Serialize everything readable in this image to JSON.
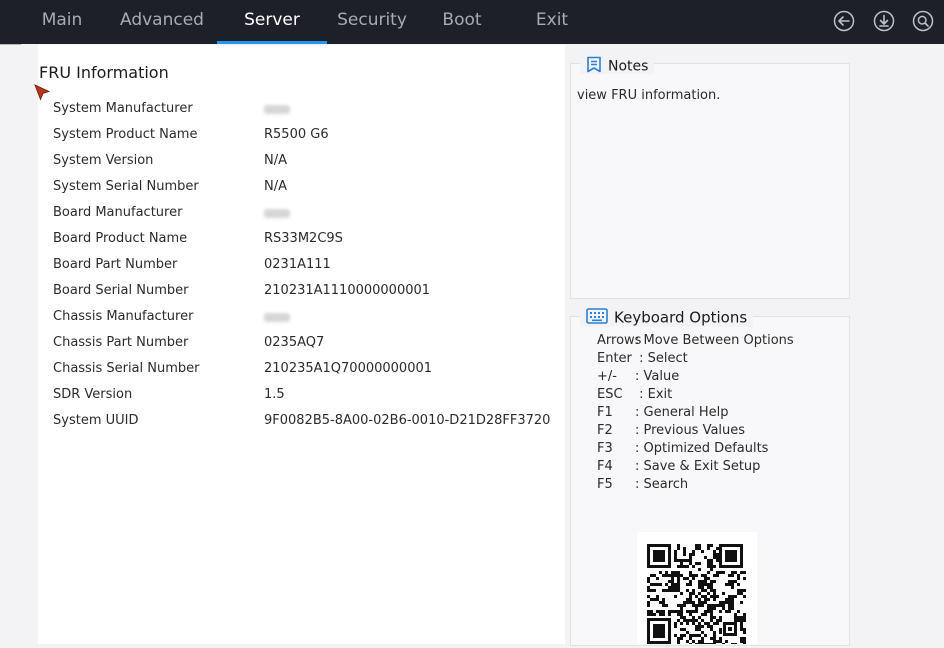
{
  "nav": {
    "tabs": [
      {
        "label": "Main"
      },
      {
        "label": "Advanced"
      },
      {
        "label": "Server"
      },
      {
        "label": "Security"
      },
      {
        "label": "Boot"
      },
      {
        "label": "Exit"
      }
    ],
    "active_tab": "Server",
    "icons": [
      "back-arrow-icon",
      "download-icon",
      "search-icon"
    ],
    "accent_color": "#2196f3"
  },
  "main": {
    "title": "FRU Information",
    "rows": [
      {
        "label": "System Manufacturer",
        "value": "",
        "redacted": true
      },
      {
        "label": "System Product Name",
        "value": "R5500 G6"
      },
      {
        "label": "System Version",
        "value": "N/A"
      },
      {
        "label": "System Serial Number",
        "value": "N/A"
      },
      {
        "label": "Board Manufacturer",
        "value": "",
        "redacted": true
      },
      {
        "label": "Board Product Name",
        "value": "RS33M2C9S"
      },
      {
        "label": "Board Part Number",
        "value": "0231A111"
      },
      {
        "label": "Board Serial Number",
        "value": "210231A1110000000001"
      },
      {
        "label": "Chassis Manufacturer",
        "value": "",
        "redacted": true
      },
      {
        "label": "Chassis Part Number",
        "value": "0235AQ7"
      },
      {
        "label": "Chassis Serial Number",
        "value": "210235A1Q70000000001"
      },
      {
        "label": "SDR Version",
        "value": "1.5"
      },
      {
        "label": "System UUID",
        "value": "9F0082B5-8A00-02B6-0010-D21D28FF3720"
      }
    ]
  },
  "notes": {
    "title": "Notes",
    "text": "view FRU information."
  },
  "keyboard": {
    "title": "Keyboard Options",
    "items": [
      {
        "key": "Arrows",
        "desc": ": Move Between Options"
      },
      {
        "key": "Enter",
        "desc": " : Select"
      },
      {
        "key": "+/-",
        "desc": ": Value"
      },
      {
        "key": "ESC",
        "desc": " : Exit"
      },
      {
        "key": "F1",
        "desc": ": General Help"
      },
      {
        "key": "F2",
        "desc": ": Previous Values"
      },
      {
        "key": "F3",
        "desc": ": Optimized Defaults"
      },
      {
        "key": "F4",
        "desc": ": Save & Exit Setup"
      },
      {
        "key": "F5",
        "desc": ": Search"
      }
    ]
  }
}
